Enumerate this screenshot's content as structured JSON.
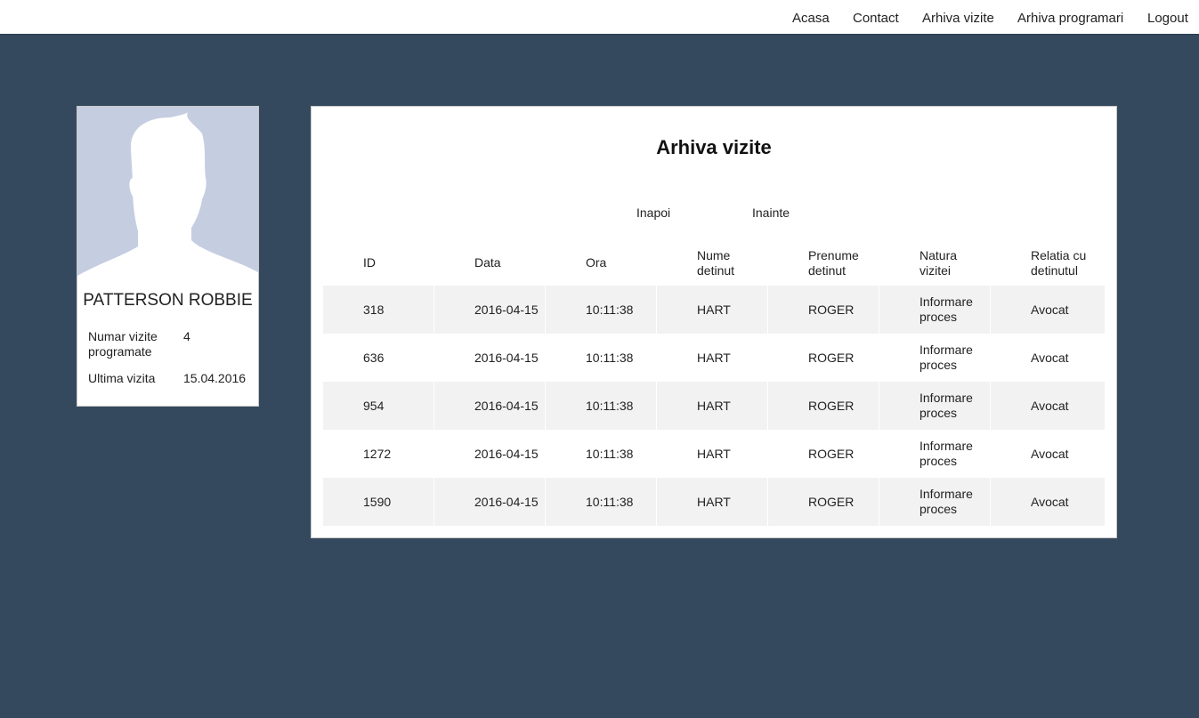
{
  "nav": {
    "items": [
      "Acasa",
      "Contact",
      "Arhiva vizite",
      "Arhiva programari",
      "Logout"
    ]
  },
  "profile": {
    "name": "PATTERSON ROBBIE",
    "stats": [
      {
        "label": "Numar vizite programate",
        "value": "4"
      },
      {
        "label": "Ultima vizita",
        "value": "15.04.2016"
      }
    ]
  },
  "panel": {
    "title": "Arhiva vizite",
    "prev_label": "Inapoi",
    "next_label": "Inainte"
  },
  "table": {
    "columns": [
      "ID",
      "Data",
      "Ora",
      "Nume detinut",
      "Prenume detinut",
      "Natura vizitei",
      "Relatia cu detinutul"
    ],
    "rows": [
      [
        "318",
        "2016-04-15",
        "10:11:38",
        "HART",
        "ROGER",
        "Informare proces",
        "Avocat"
      ],
      [
        "636",
        "2016-04-15",
        "10:11:38",
        "HART",
        "ROGER",
        "Informare proces",
        "Avocat"
      ],
      [
        "954",
        "2016-04-15",
        "10:11:38",
        "HART",
        "ROGER",
        "Informare proces",
        "Avocat"
      ],
      [
        "1272",
        "2016-04-15",
        "10:11:38",
        "HART",
        "ROGER",
        "Informare proces",
        "Avocat"
      ],
      [
        "1590",
        "2016-04-15",
        "10:11:38",
        "HART",
        "ROGER",
        "Informare proces",
        "Avocat"
      ]
    ]
  },
  "colors": {
    "page_background": "#34495e",
    "avatar_background": "#c5cde0",
    "row_stripe": "#f2f2f2"
  }
}
